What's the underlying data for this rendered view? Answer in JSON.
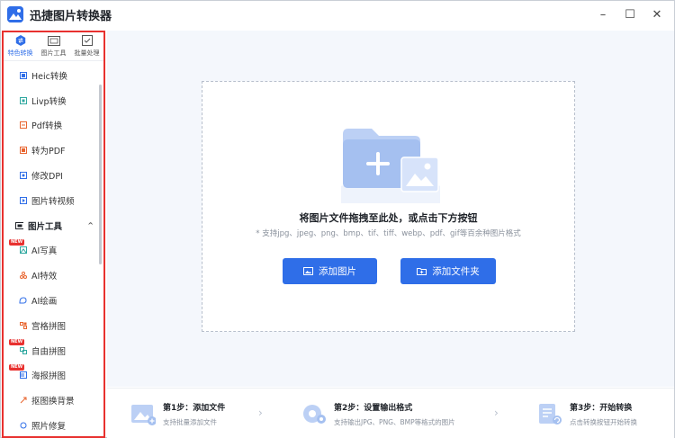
{
  "app": {
    "title": "迅捷图片转换器"
  },
  "window_controls": {
    "minimize": "–",
    "maximize": "☐",
    "close": "✕"
  },
  "colors": {
    "accent": "#2f6ee8",
    "highlight_border": "#e8312f",
    "new_badge": "#e8312f"
  },
  "sidebar": {
    "tabs": [
      {
        "label": "特色转换",
        "icon": "convert-icon",
        "active": true
      },
      {
        "label": "图片工具",
        "icon": "image-tool-icon",
        "active": false
      },
      {
        "label": "批量处理",
        "icon": "batch-icon",
        "active": false
      }
    ],
    "items": [
      {
        "label": "Heic转换",
        "icon": "heic-icon"
      },
      {
        "label": "Livp转换",
        "icon": "livp-icon"
      },
      {
        "label": "Pdf转换",
        "icon": "pdf-icon"
      },
      {
        "label": "转为PDF",
        "icon": "to-pdf-icon"
      },
      {
        "label": "修改DPI",
        "icon": "dpi-icon"
      },
      {
        "label": "图片转视频",
        "icon": "video-icon"
      },
      {
        "label": "图片工具",
        "icon": "image-tool-icon",
        "section": true,
        "chevron": "^"
      },
      {
        "label": "AI写真",
        "icon": "ai-portrait-icon",
        "badge": "NEW"
      },
      {
        "label": "AI特效",
        "icon": "ai-effect-icon"
      },
      {
        "label": "AI绘画",
        "icon": "ai-paint-icon"
      },
      {
        "label": "宫格拼图",
        "icon": "grid-icon"
      },
      {
        "label": "自由拼图",
        "icon": "free-collage-icon",
        "badge": "NEW"
      },
      {
        "label": "海报拼图",
        "icon": "poster-icon",
        "badge": "NEW"
      },
      {
        "label": "抠图换背景",
        "icon": "cutout-icon"
      },
      {
        "label": "照片修复",
        "icon": "repair-icon"
      }
    ]
  },
  "dropzone": {
    "title": "将图片文件拖拽至此处，或点击下方按钮",
    "subtitle": "* 支持jpg、jpeg、png、bmp、tif、tiff、webp、pdf、gif等百余种图片格式",
    "add_image_label": "添加图片",
    "add_folder_label": "添加文件夹"
  },
  "steps": [
    {
      "title": "第1步：添加文件",
      "desc": "支持批量添加文件"
    },
    {
      "title": "第2步：设置输出格式",
      "desc": "支持输出JPG、PNG、BMP等格式的图片"
    },
    {
      "title": "第3步：开始转换",
      "desc": "点击转换按钮开始转换"
    }
  ],
  "step_arrow": "›"
}
